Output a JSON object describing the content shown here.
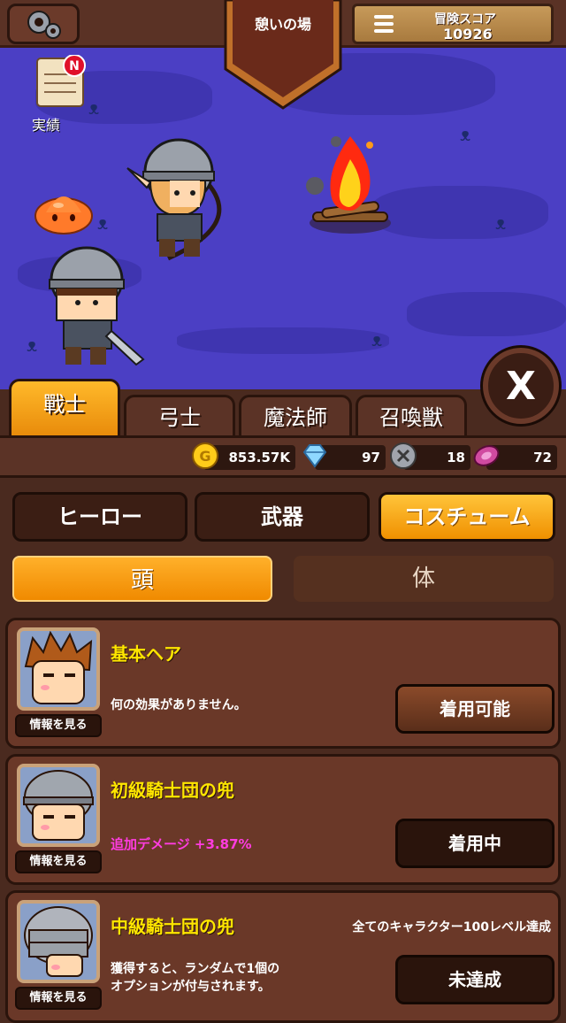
{
  "scene": {
    "location_title": "憩いの場",
    "score_label": "冒険スコア",
    "score_value": "10926",
    "achievement_label": "実績",
    "achievement_badge": "N"
  },
  "class_tabs": [
    {
      "label": "戰士",
      "active": true
    },
    {
      "label": "弓士",
      "active": false
    },
    {
      "label": "魔法師",
      "active": false
    },
    {
      "label": "召喚獣",
      "active": false
    }
  ],
  "currencies": {
    "gold": "853.57K",
    "diamond": "97",
    "coin": "18",
    "gem": "72"
  },
  "categories": [
    {
      "label": "ヒーロー",
      "active": false
    },
    {
      "label": "武器",
      "active": false
    },
    {
      "label": "コスチューム",
      "active": true
    }
  ],
  "subcategories": [
    {
      "label": "頭",
      "active": true
    },
    {
      "label": "体",
      "active": false
    }
  ],
  "items": [
    {
      "name": "基本ヘア",
      "description": "何の効果がありません。",
      "info_label": "情報を見る",
      "button_label": "着用可能",
      "status": "available"
    },
    {
      "name": "初級騎士団の兜",
      "bonus": "追加デメージ +3.87%",
      "info_label": "情報を見る",
      "button_label": "着用中",
      "status": "equipped"
    },
    {
      "name": "中級騎士団の兜",
      "requirement": "全てのキャラクター100レベル達成",
      "description_line1": "獲得すると、ランダムで1個の",
      "description_line2": "オプションが付与されます。",
      "info_label": "情報を見る",
      "button_label": "未達成",
      "status": "locked"
    }
  ],
  "colors": {
    "accent_orange": "#f09000",
    "item_name": "#ffe600",
    "bonus_text": "#ff3ce0",
    "scene_bg": "#4b3fc4"
  }
}
